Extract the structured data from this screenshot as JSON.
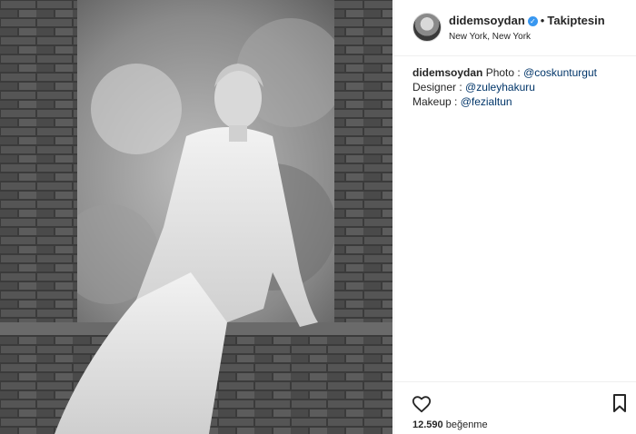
{
  "post": {
    "photo_alt": "",
    "username": "didemsoydan",
    "verified": true,
    "separator": "•",
    "follow_label": "Takiptesin",
    "location": "New York, New York",
    "caption": {
      "username": "didemsoydan",
      "line1_prefix": "Photo : ",
      "line1_mention": "@coskunturgut",
      "line2_prefix": "Designer : ",
      "line2_mention": "@zuleyhakuru",
      "line3_prefix": "Makeup : ",
      "line3_mention": "@fezialtun"
    },
    "likes_count": "12.590",
    "likes_label": "beğenme"
  },
  "colors": {
    "accent": "#3897f0",
    "mention": "#003569",
    "text": "#262626",
    "border": "#efefef"
  },
  "icons": [
    "verified-badge-icon",
    "heart-icon",
    "bookmark-icon"
  ]
}
